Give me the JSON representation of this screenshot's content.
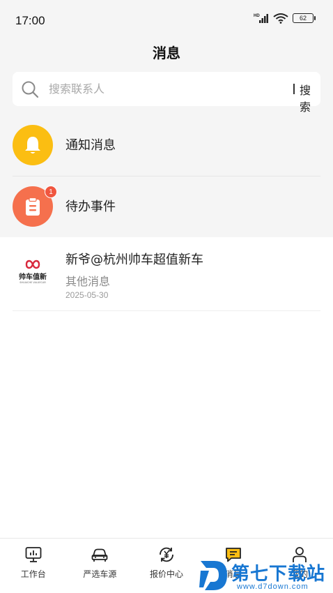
{
  "status_bar": {
    "time": "17:00",
    "network": "HD",
    "battery": "62"
  },
  "header": {
    "title": "消息"
  },
  "search": {
    "placeholder": "搜索联系人",
    "button_label": "搜索"
  },
  "rows": [
    {
      "label": "通知消息",
      "color": "#fbbe12"
    },
    {
      "label": "待办事件",
      "color": "#f5704d",
      "badge": "1"
    }
  ],
  "messages": [
    {
      "title": "新爷@杭州帅车超值新车",
      "subtitle": "其他消息",
      "date": "2025-05-30",
      "logo_text": "帅车值新",
      "logo_sub": "SHUAICHE VALUECAR"
    }
  ],
  "tabs": [
    {
      "label": "工作台",
      "icon": "monitor-icon"
    },
    {
      "label": "严选车源",
      "icon": "car-icon"
    },
    {
      "label": "报价中心",
      "icon": "yuan-exchange-icon"
    },
    {
      "label": "消息",
      "icon": "message-icon",
      "active": true
    },
    {
      "label": "我的",
      "icon": "user-icon"
    }
  ],
  "watermark": {
    "brand": "第七下载站",
    "url": "www.d7down.com"
  },
  "colors": {
    "accent": "#fbbe12",
    "todo": "#f5704d",
    "badge": "#f0563f",
    "watermark": "#1877d2"
  }
}
